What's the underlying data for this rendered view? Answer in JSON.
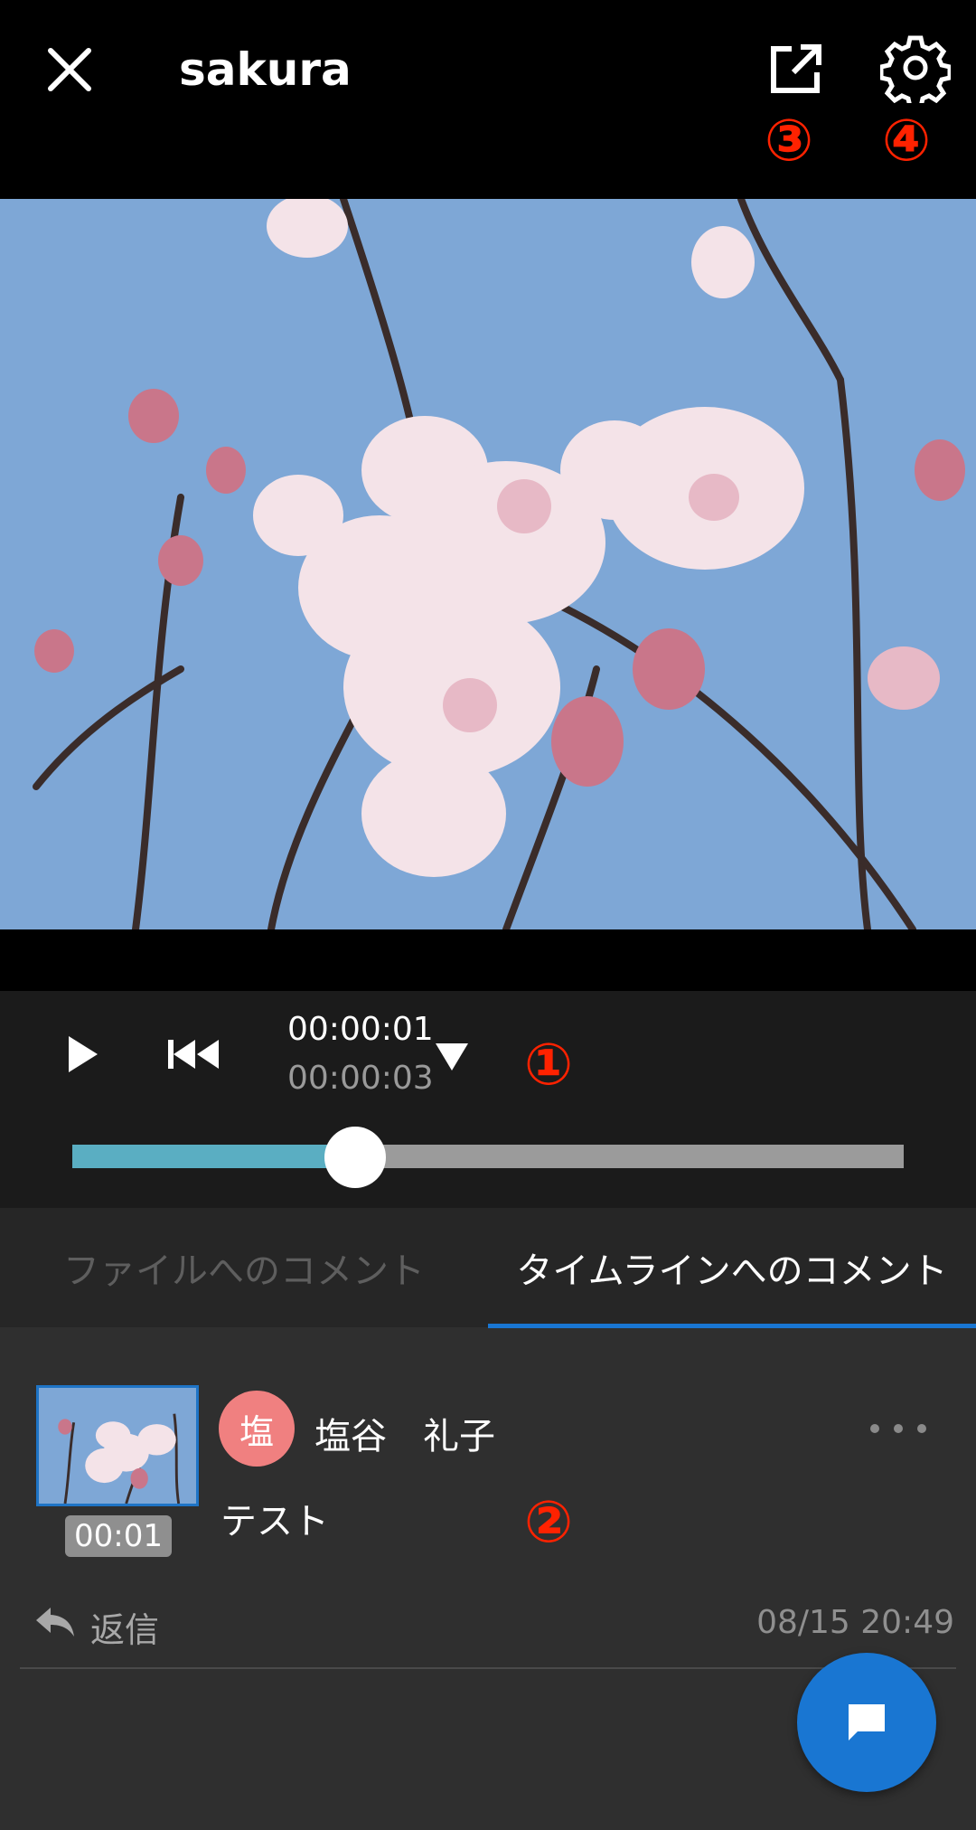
{
  "header": {
    "title": "sakura",
    "close_icon": "close-icon",
    "share_icon": "open-external-icon",
    "settings_icon": "gear-icon"
  },
  "annotations": {
    "share": "③",
    "settings": "④",
    "playback": "①",
    "comment": "②"
  },
  "player": {
    "current_time": "00:00:01",
    "total_time": "00:00:03",
    "progress": 0.34,
    "colors": {
      "fill": "#5aaec2",
      "track": "#9b9b9b"
    }
  },
  "tabs": [
    {
      "label": "ファイルへのコメント",
      "active": false
    },
    {
      "label": "タイムラインへのコメント",
      "active": true
    }
  ],
  "comment": {
    "thumb_time": "00:01",
    "avatar_text": "塩",
    "author": "塩谷　礼子",
    "text": "テスト",
    "reply_label": "返信",
    "timestamp": "08/15 20:49"
  },
  "colors": {
    "accent": "#1976d2",
    "annotation": "#ff2200",
    "avatar": "#f08080"
  }
}
